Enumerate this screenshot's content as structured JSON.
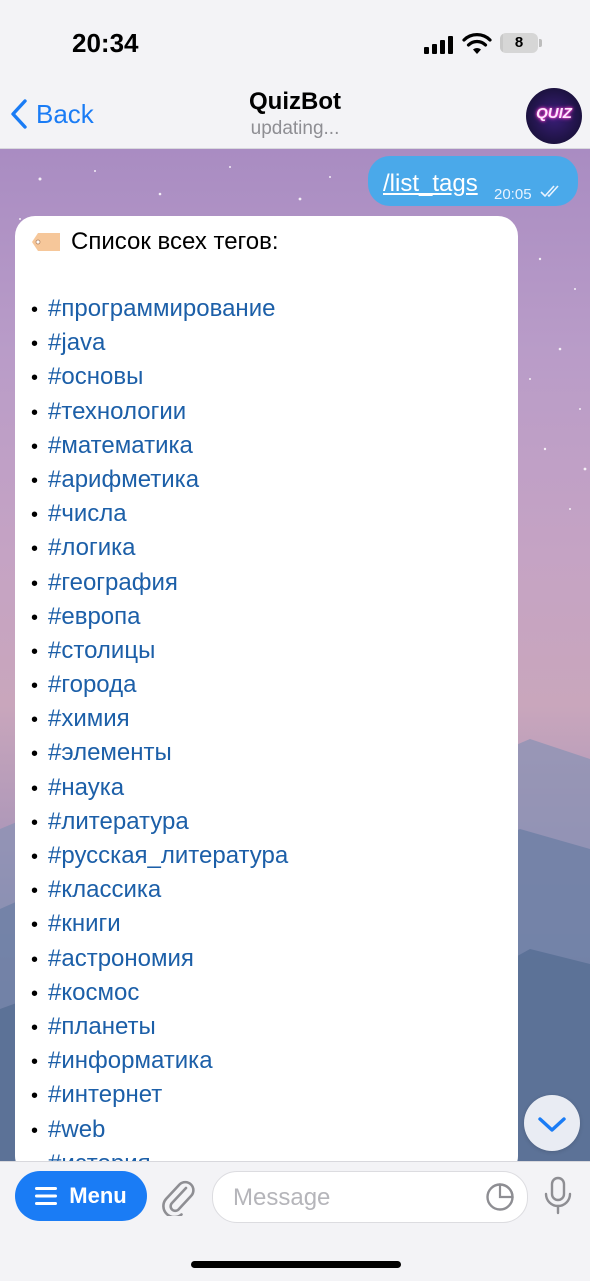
{
  "status_bar": {
    "time": "20:34",
    "battery": "8",
    "battery_level_percent": 8
  },
  "header": {
    "back_label": "Back",
    "title": "QuizBot",
    "subtitle": "updating...",
    "avatar_text": "QUIZ"
  },
  "outgoing_message": {
    "text": "/list_tags",
    "time": "20:05"
  },
  "incoming_message": {
    "heading_emoji": "label-tag-emoji",
    "heading": "Список всех тегов:",
    "bullet": "•",
    "tags": [
      "#программирование",
      "#java",
      "#основы",
      "#технологии",
      "#математика",
      "#арифметика",
      "#числа",
      "#логика",
      "#география",
      "#европа",
      "#столицы",
      "#города",
      "#химия",
      "#элементы",
      "#наука",
      "#литература",
      "#русская_литература",
      "#классика",
      "#книги",
      "#астрономия",
      "#космос",
      "#планеты",
      "#информатика",
      "#интернет",
      "#web",
      "#история"
    ]
  },
  "composer": {
    "menu_label": "Menu",
    "placeholder": "Message"
  },
  "colors": {
    "accent": "#1a7cf5",
    "outgoing_bubble": "#4aa9ea",
    "link": "#1c5fa8"
  }
}
